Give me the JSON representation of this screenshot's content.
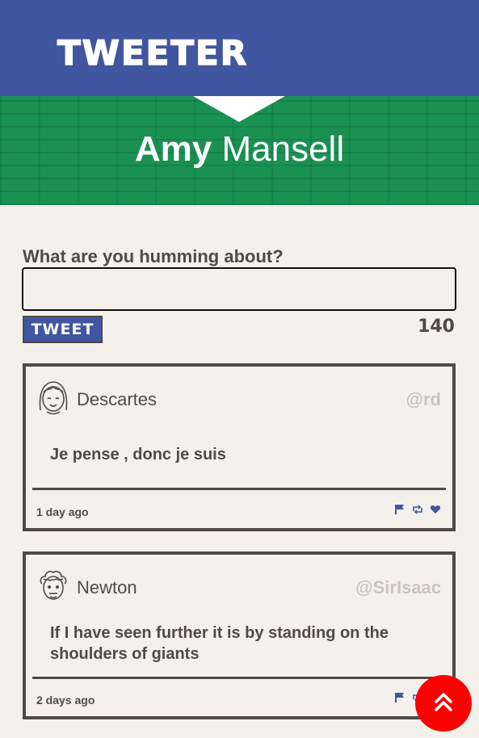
{
  "header": {
    "brand": "Tweeter"
  },
  "profile": {
    "first_name": "Amy",
    "last_name": "Mansell"
  },
  "composer": {
    "label": "What are you humming about?",
    "value": "",
    "placeholder": "",
    "button_label": "Tweet",
    "char_count": "140"
  },
  "tweets": [
    {
      "author": "Descartes",
      "handle": "@rd",
      "text": "Je pense , donc je suis",
      "timestamp": "1 day ago",
      "avatar_icon": "girl-face-avatar-icon"
    },
    {
      "author": "Newton",
      "handle": "@SirIsaac",
      "text": "If I have seen further it is by standing on the shoulders of giants",
      "timestamp": "2 days ago",
      "avatar_icon": "curly-hair-face-avatar-icon"
    }
  ],
  "icons": {
    "flag": "flag-icon",
    "retweet": "retweet-icon",
    "like": "heart-icon",
    "scroll_top": "double-chevron-up-icon"
  },
  "colors": {
    "nav": "#4056a1",
    "hero": "#1a9153",
    "background": "#f4f1ec",
    "text": "#4f4a45",
    "handle": "#c9c4bd",
    "scroll_button": "#ff0000"
  }
}
